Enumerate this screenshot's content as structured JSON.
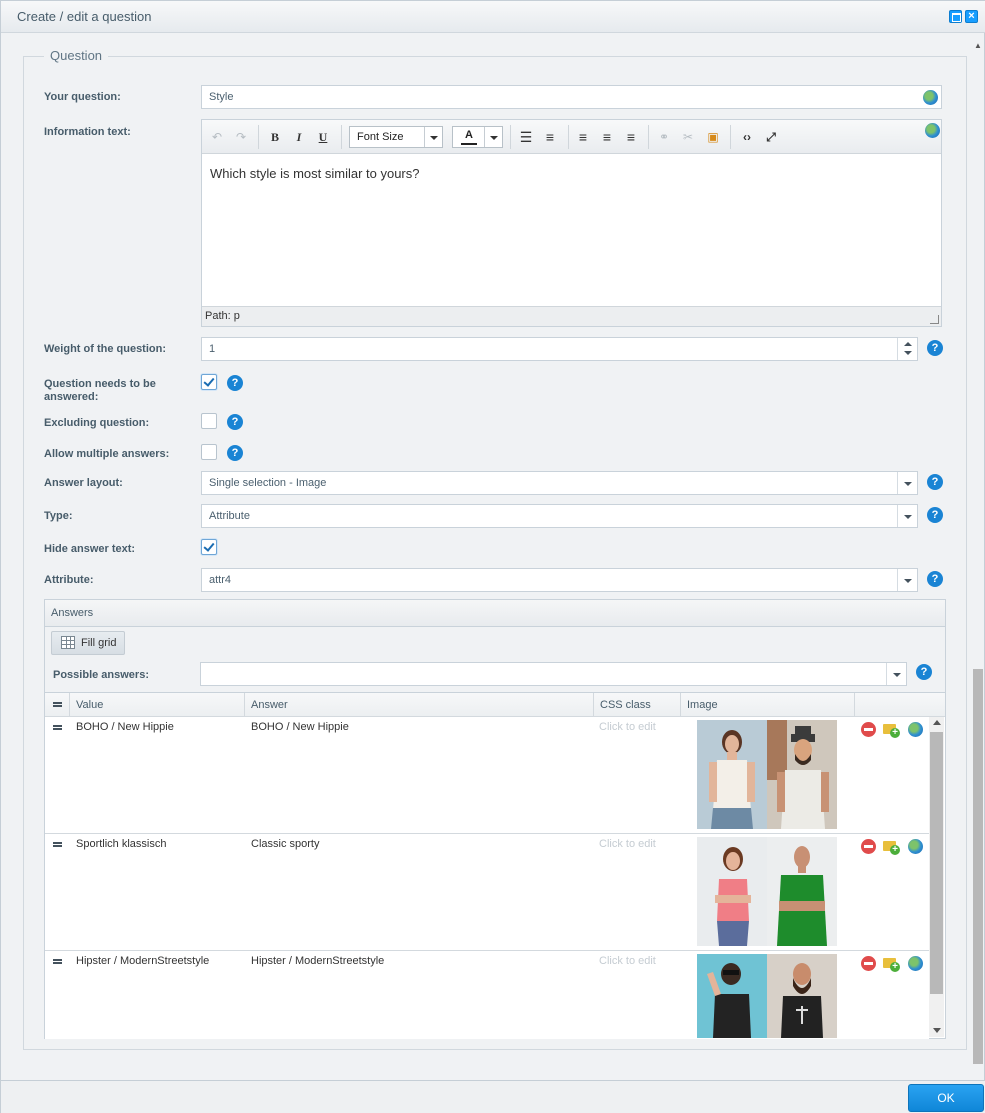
{
  "window": {
    "title": "Create / edit a question"
  },
  "fieldset": {
    "legend": "Question"
  },
  "fields": {
    "question_label": "Your question:",
    "question_value": "Style",
    "info_label": "Information text:",
    "info_text": "Which style is most similar to yours?",
    "font_size_select": "Font Size",
    "editor_path": "Path: p",
    "weight_label": "Weight of the question:",
    "weight_value": "1",
    "needs_answer_label": "Question needs to be answered:",
    "needs_answer_checked": true,
    "excluding_label": "Excluding question:",
    "excluding_checked": false,
    "multiple_label": "Allow multiple answers:",
    "multiple_checked": false,
    "layout_label": "Answer layout:",
    "layout_value": "Single selection - Image",
    "type_label": "Type:",
    "type_value": "Attribute",
    "hide_text_label": "Hide answer text:",
    "hide_text_checked": true,
    "attribute_label": "Attribute:",
    "attribute_value": "attr4"
  },
  "answers": {
    "title": "Answers",
    "fill_grid": "Fill grid",
    "possible_label": "Possible answers:",
    "possible_value": "",
    "columns": [
      "Value",
      "Answer",
      "CSS class",
      "Image"
    ],
    "rows": [
      {
        "value": "BOHO / New Hippie",
        "answer": "BOHO / New Hippie",
        "css": "Click to edit"
      },
      {
        "value": "Sportlich klassisch",
        "answer": "Classic sporty",
        "css": "Click to edit"
      },
      {
        "value": "Hipster / ModernStreetstyle",
        "answer": "Hipster / ModernStreetstyle",
        "css": "Click to edit"
      }
    ]
  },
  "footer": {
    "ok": "OK"
  },
  "help_glyph": "?"
}
